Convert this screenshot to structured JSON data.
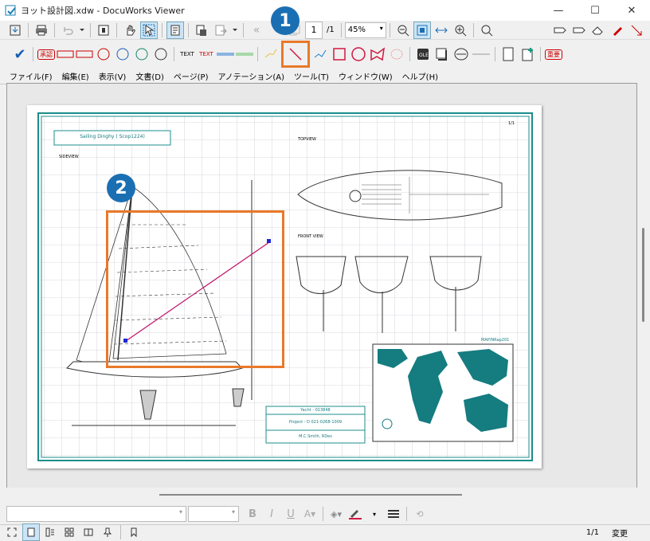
{
  "window": {
    "title": "ヨット設計図.xdw - DocuWorks Viewer",
    "minimize": "—",
    "maximize": "☐",
    "close": "✕"
  },
  "toolbar": {
    "page_current": "1",
    "page_total": "/1",
    "zoom": "45%"
  },
  "annotation_tools": {
    "text1": "TEXT",
    "text2": "TEXT",
    "stamp_approve": "承認",
    "stamp_urgent": "重要"
  },
  "menu": [
    "ファイル(F)",
    "編集(E)",
    "表示(V)",
    "文書(D)",
    "ページ(P)",
    "アノテーション(A)",
    "ツール(T)",
    "ウィンドウ(W)",
    "ヘルプ(H)"
  ],
  "drawing": {
    "title_box": "Sailing Dinghy ( Scop1224)",
    "side_view": "SIDEVIEW",
    "top_view": "TOPVIEW",
    "front_view": "FRONT VIEW",
    "page_no": "1/1",
    "map_label": "MAP/NRap201",
    "titleblock": [
      "Yacht - 013848",
      "Project - D   021-0268-1009",
      "M.C.Smith, RDes"
    ]
  },
  "callouts": {
    "one": "1",
    "two": "2"
  },
  "status": {
    "page": "1/1",
    "mode": "変更"
  },
  "colors": {
    "accent": "#e8792a",
    "badge": "#1a6fb3",
    "border": "#1c8c8c",
    "line": "#c0106a"
  }
}
